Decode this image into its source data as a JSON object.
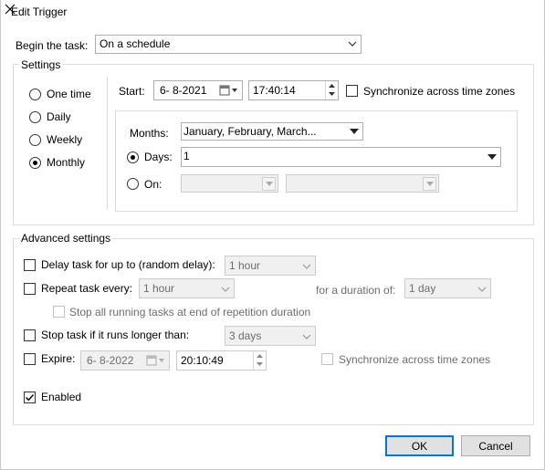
{
  "window": {
    "title": "Edit Trigger"
  },
  "begin": {
    "label": "Begin the task:",
    "value": "On a schedule"
  },
  "settings": {
    "legend": "Settings",
    "schedule_options": [
      {
        "label": "One time",
        "selected": false
      },
      {
        "label": "Daily",
        "selected": false
      },
      {
        "label": "Weekly",
        "selected": false
      },
      {
        "label": "Monthly",
        "selected": true
      }
    ],
    "start_label": "Start:",
    "start_date": "6- 8-2021",
    "start_time": "17:40:14",
    "sync_label": "Synchronize across time zones",
    "months_label": "Months:",
    "months_value": "January, February, March...",
    "days_label": "Days:",
    "days_value": "1",
    "on_label": "On:"
  },
  "advanced": {
    "legend": "Advanced settings",
    "delay_label": "Delay task for up to (random delay):",
    "delay_value": "1 hour",
    "repeat_label": "Repeat task every:",
    "repeat_value": "1 hour",
    "duration_label": "for a duration of:",
    "duration_value": "1 day",
    "stop_running_label": "Stop all running tasks at end of repetition duration",
    "stop_if_label": "Stop task if it runs longer than:",
    "stop_if_value": "3 days",
    "expire_label": "Expire:",
    "expire_date": "6- 8-2022",
    "expire_time": "20:10:49",
    "expire_sync_label": "Synchronize across time zones",
    "enabled_label": "Enabled",
    "enabled_checked": true
  },
  "buttons": {
    "ok": "OK",
    "cancel": "Cancel"
  }
}
